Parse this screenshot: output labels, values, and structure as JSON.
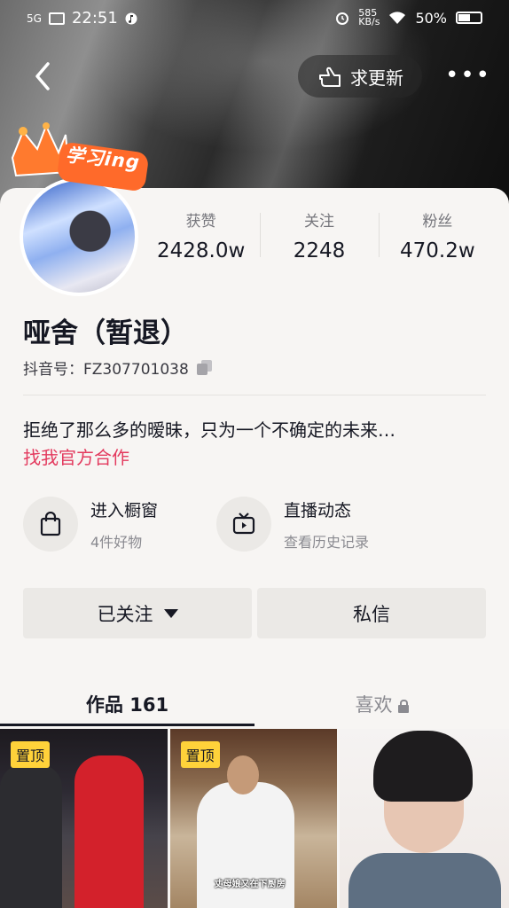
{
  "status_bar": {
    "network": "5G",
    "time": "22:51",
    "speed_value": "585",
    "speed_unit": "KB/s",
    "battery": "50%"
  },
  "header": {
    "update_button_label": "求更新",
    "more_label": "•••"
  },
  "badge": {
    "label": "学习ing"
  },
  "profile": {
    "name": "哑舍（暂退）",
    "douyin_id": "抖音号：FZ307701038",
    "bio": "拒绝了那么多的暧昧，只为一个不确定的未来…",
    "bio_link": "找我官方合作"
  },
  "stats": [
    {
      "label": "获赞",
      "value": "2428.0w"
    },
    {
      "label": "关注",
      "value": "2248"
    },
    {
      "label": "粉丝",
      "value": "470.2w"
    }
  ],
  "features": [
    {
      "title": "进入橱窗",
      "subtitle": "4件好物",
      "icon": "shopping-bag-icon"
    },
    {
      "title": "直播动态",
      "subtitle": "查看历史记录",
      "icon": "tv-icon"
    }
  ],
  "actions": {
    "follow_label": "已关注",
    "message_label": "私信"
  },
  "tabs": [
    {
      "label": "作品 161",
      "active": true
    },
    {
      "label": "喜欢",
      "active": false,
      "locked": true
    }
  ],
  "videos": [
    {
      "pinned_label": "置顶",
      "caption": ""
    },
    {
      "pinned_label": "置顶",
      "caption": "丈母娘又在下厨房"
    },
    {
      "pinned_label": "",
      "caption": ""
    }
  ],
  "colors": {
    "accent_link": "#e33a5e",
    "pin_badge": "#ffd23a"
  }
}
